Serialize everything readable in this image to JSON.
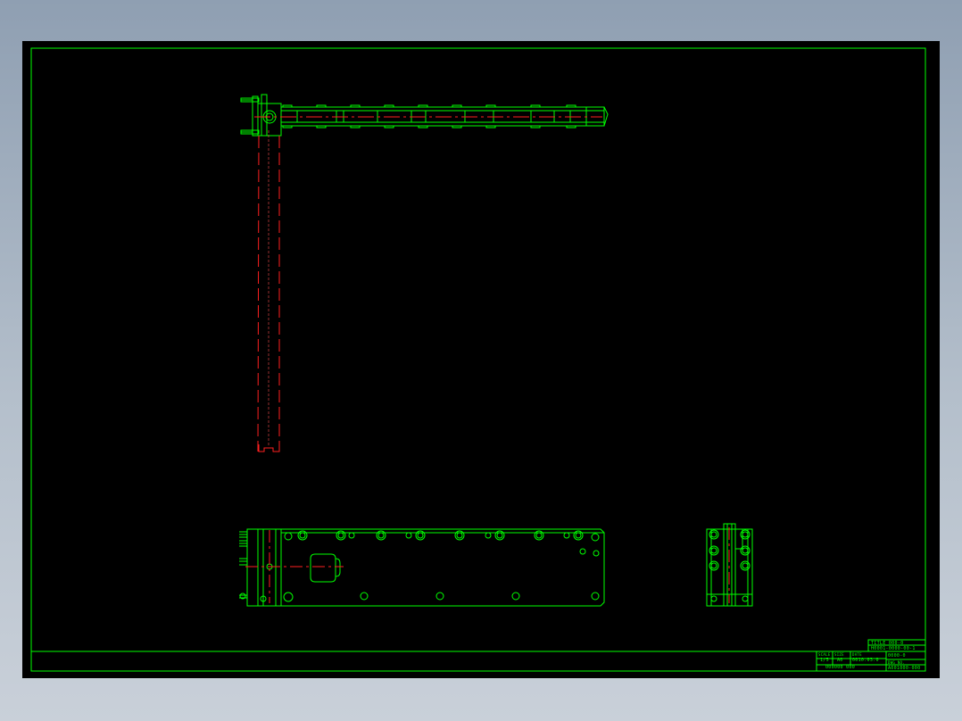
{
  "colors": {
    "line": "#00ff00",
    "hidden_line": "#ff2020",
    "center_line": "#ff2020",
    "background": "#000000"
  },
  "title_block": {
    "title_top": "TITLE 000-0",
    "title_part": "H0001-0000-00-1",
    "scale_label": "SCALE",
    "scale_value": "1/5",
    "size_label": "SIZE",
    "size_value": "A0",
    "date_label": "DATE",
    "date_value": "0010.03.0",
    "name_value": "0000-0",
    "sheet_label": "SHEET",
    "company": "000000 000",
    "drawing_no_label": "DWG NO.",
    "drawing_no": "A001000-000"
  }
}
